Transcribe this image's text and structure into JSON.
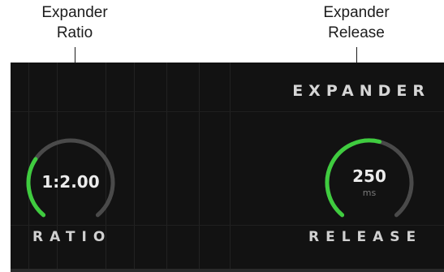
{
  "callouts": {
    "ratio": {
      "line1": "Expander",
      "line2": "Ratio"
    },
    "release": {
      "line1": "Expander",
      "line2": "Release"
    }
  },
  "panel": {
    "section_title": "EXPANDER",
    "knobs": {
      "ratio": {
        "value": "1:2.00",
        "unit": "",
        "label": "RATIO",
        "level": 0.3
      },
      "release": {
        "value": "250",
        "unit": "ms",
        "label": "RELEASE",
        "level": 0.55
      }
    }
  },
  "colors": {
    "panel_bg": "#121212",
    "knob_track": "#4a4a4a",
    "knob_active": "#3fcc3f",
    "text": "#ececec"
  }
}
